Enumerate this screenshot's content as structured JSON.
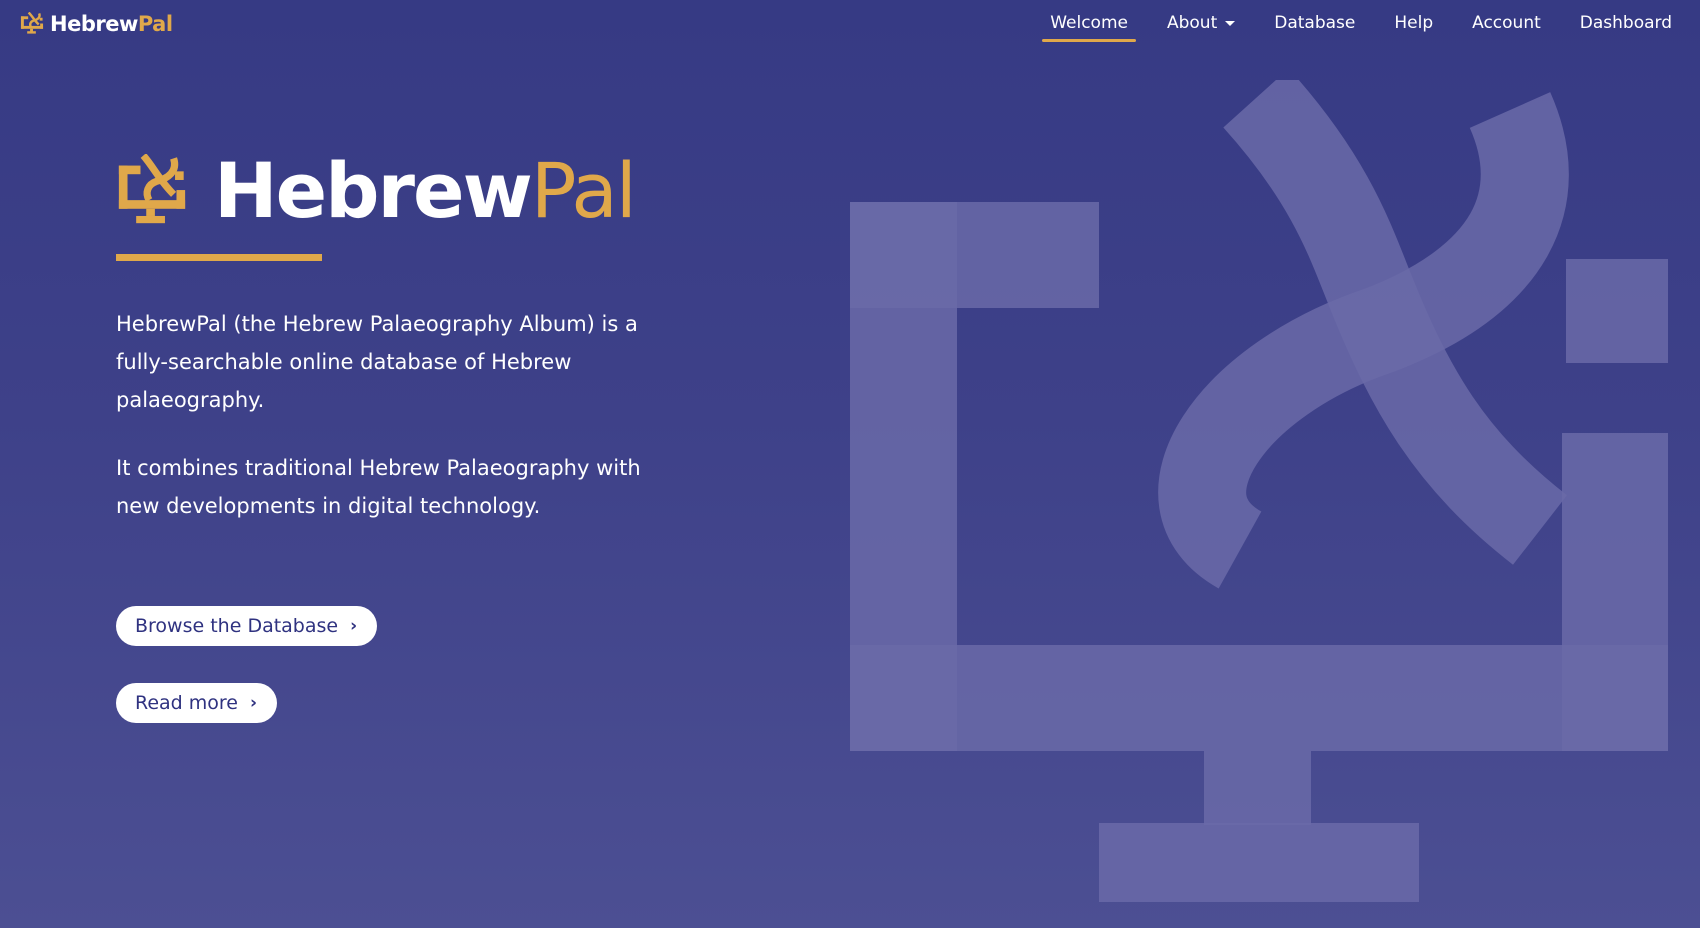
{
  "colors": {
    "background_top": "#363a84",
    "background_bottom": "#4c4f93",
    "accent": "#e0a84a",
    "mark": "#6a6aa8",
    "button_text": "#2f3280"
  },
  "brand": {
    "icon": "hebrewpal-logo-icon",
    "name_part1": "Hebrew",
    "name_part2": "Pal"
  },
  "nav": {
    "items": [
      {
        "label": "Welcome",
        "active": true
      },
      {
        "label": "About",
        "dropdown": true
      },
      {
        "label": "Database"
      },
      {
        "label": "Help"
      },
      {
        "label": "Account"
      },
      {
        "label": "Dashboard"
      }
    ]
  },
  "hero": {
    "title_part1": "Hebrew",
    "title_part2": "Pal",
    "paragraphs": [
      "HebrewPal (the Hebrew Palaeography Album) is a fully-searchable online database of Hebrew palaeography.",
      "It combines traditional Hebrew Palaeography with new developments in digital technology."
    ],
    "buttons": {
      "browse": {
        "label": "Browse the Database",
        "icon": "chevron-right-icon"
      },
      "read": {
        "label": "Read more",
        "icon": "chevron-right-icon"
      }
    }
  }
}
